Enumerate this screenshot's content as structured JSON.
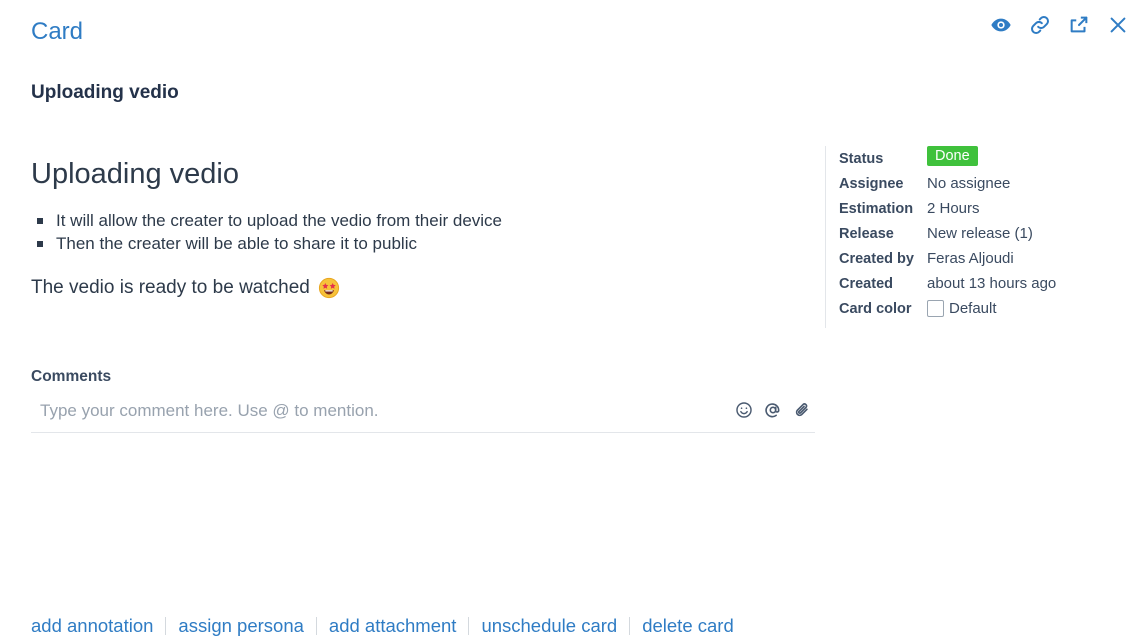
{
  "header": {
    "title": "Card",
    "icons": [
      "eye-icon",
      "link-icon",
      "share-icon",
      "close-icon"
    ]
  },
  "card": {
    "name": "Uploading vedio"
  },
  "content": {
    "heading": "Uploading vedio",
    "bullets": [
      "It will allow the creater to upload the vedio from their device",
      "Then the creater will be able to share it to public"
    ],
    "paragraph": "The vedio is ready to be watched",
    "emoji": "star-struck-emoji"
  },
  "sidebar": {
    "status_label": "Status",
    "status_value": "Done",
    "status_color": "#3fc13c",
    "assignee_label": "Assignee",
    "assignee_value": "No assignee",
    "estimation_label": "Estimation",
    "estimation_value": "2 Hours",
    "release_label": "Release",
    "release_value": "New release (1)",
    "created_by_label": "Created by",
    "created_by_value": "Feras Aljoudi",
    "created_label": "Created",
    "created_value": "about 13 hours ago",
    "card_color_label": "Card color",
    "card_color_value": "Default"
  },
  "comments": {
    "label": "Comments",
    "placeholder": "Type your comment here. Use @ to mention.",
    "tools": [
      "smiley-icon",
      "at-icon",
      "paperclip-icon"
    ]
  },
  "footer": {
    "links": [
      "add annotation",
      "assign persona",
      "add attachment",
      "unschedule card",
      "delete card"
    ]
  },
  "colors": {
    "accent": "#2f7cc4",
    "text": "#2d3a4a",
    "status_done": "#3fc13c"
  }
}
